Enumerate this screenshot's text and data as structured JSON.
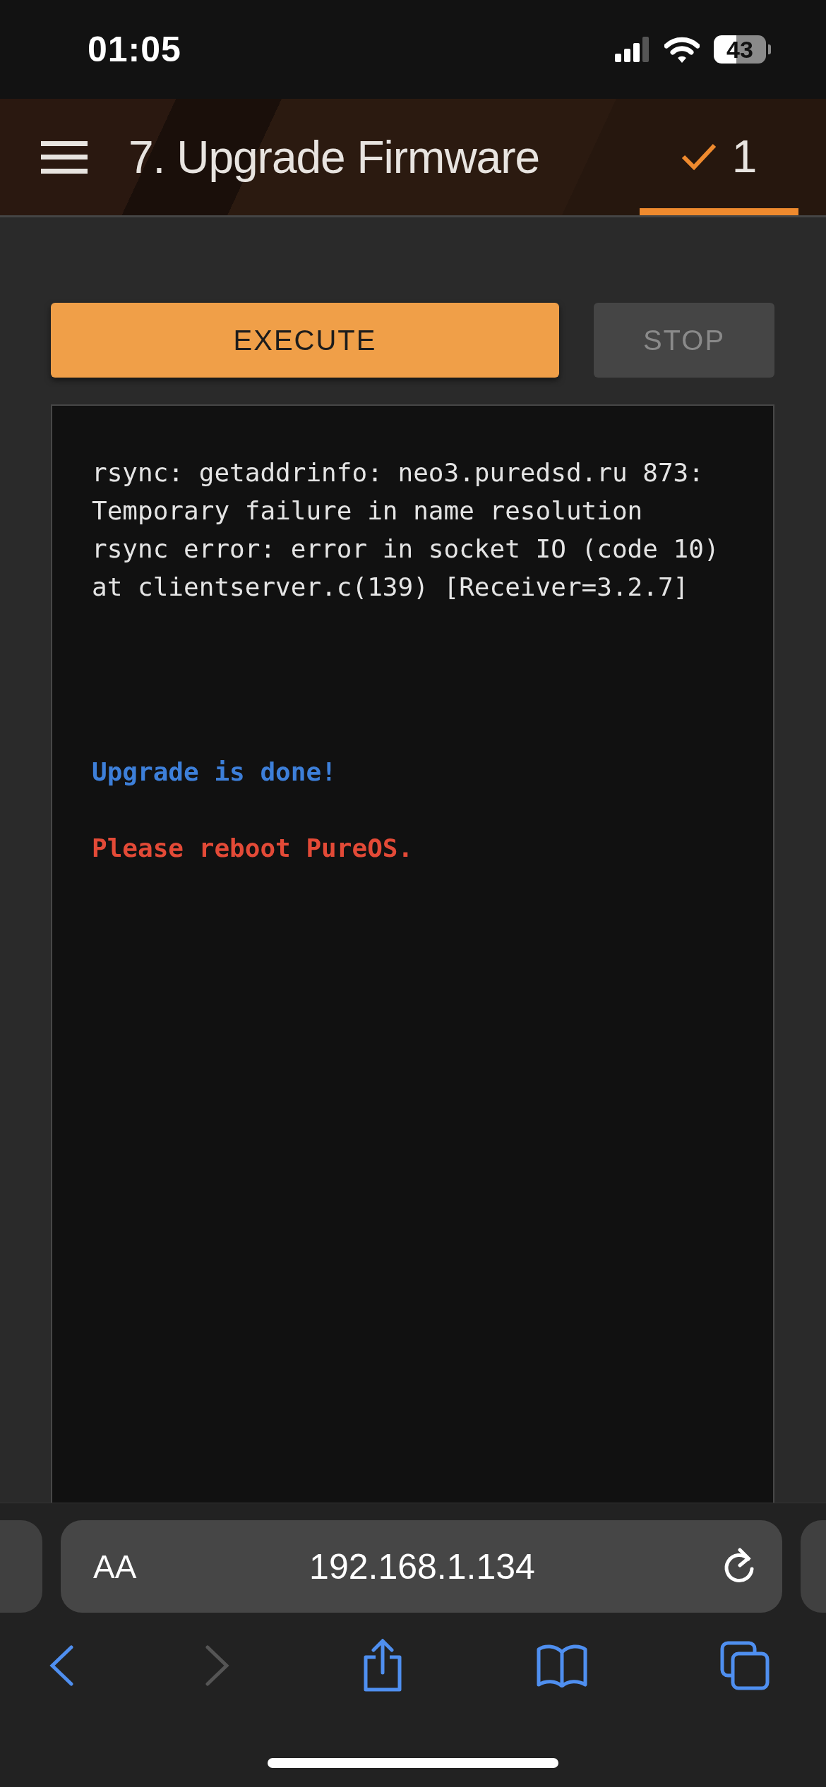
{
  "status_bar": {
    "time": "01:05",
    "battery": "43"
  },
  "header": {
    "title": "7. Upgrade Firmware",
    "step_tab": {
      "label": "1",
      "selected": true
    }
  },
  "buttons": [
    {
      "label": "EXECUTE",
      "disabled": false
    },
    {
      "label": "STOP",
      "disabled": true
    }
  ],
  "log": [
    {
      "kind": "output",
      "text": "rsync: getaddrinfo: neo3.puredsd.ru 873:"
    },
    {
      "kind": "output",
      "text": "Temporary failure in name resolution"
    },
    {
      "kind": "output",
      "text": "rsync error: error in socket IO (code 10)"
    },
    {
      "kind": "output",
      "text": "at clientserver.c(139) [Receiver=3.2.7]"
    },
    {
      "kind": "info",
      "text": "Upgrade is done!"
    },
    {
      "kind": "error",
      "text": "Please reboot PureOS."
    }
  ],
  "browser": {
    "url": "192.168.1.134",
    "text_size_label": "AA"
  }
}
